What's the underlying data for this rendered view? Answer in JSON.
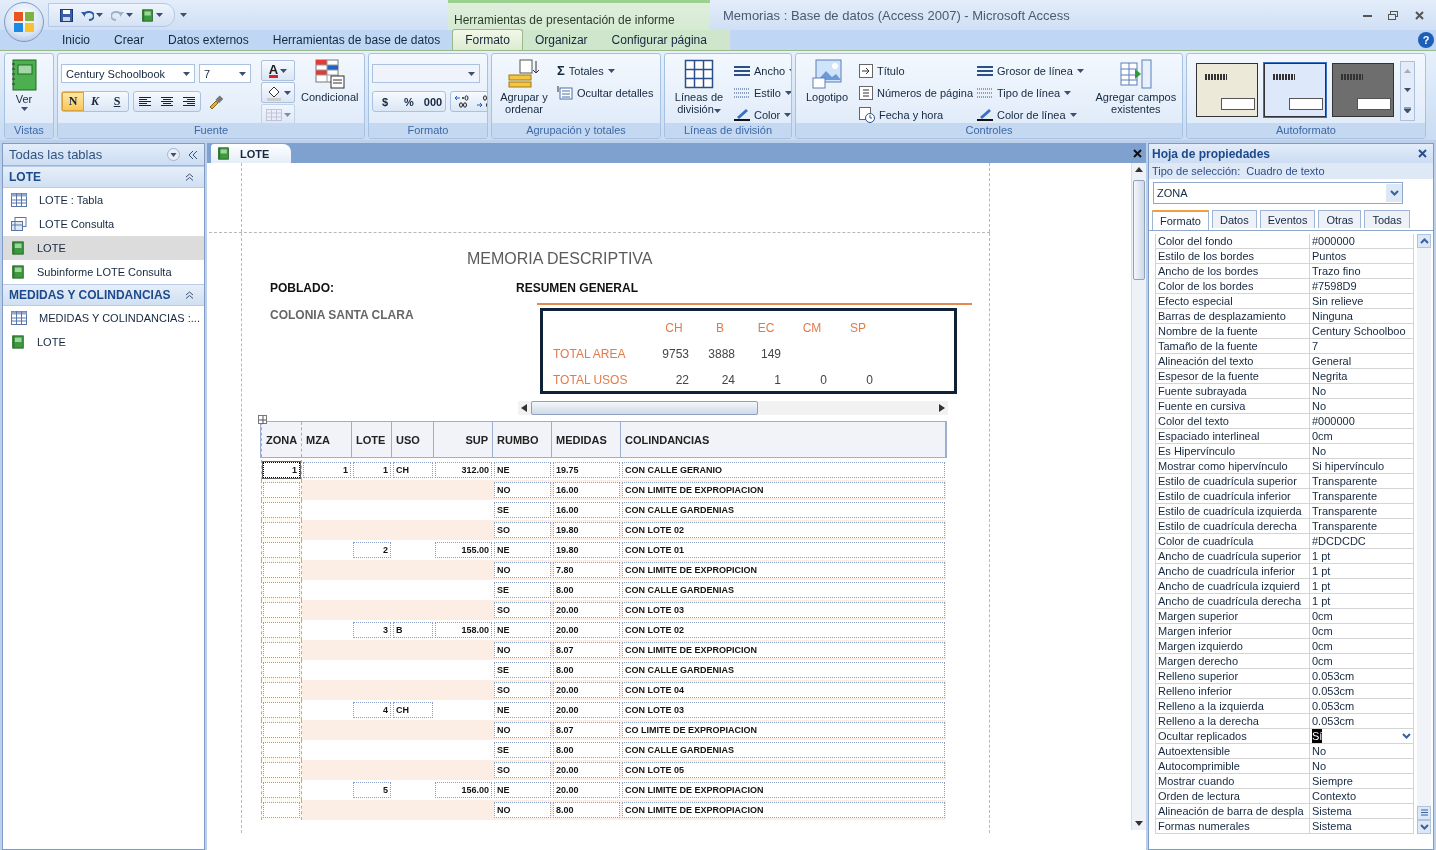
{
  "title_bar": {
    "context_group": "Herramientas de presentación de informe",
    "title": "Memorias : Base de datos (Access 2007) - Microsoft Access"
  },
  "ribbon_tabs": [
    {
      "label": "Inicio",
      "selected": false
    },
    {
      "label": "Crear",
      "selected": false
    },
    {
      "label": "Datos externos",
      "selected": false
    },
    {
      "label": "Herramientas de base de datos",
      "selected": false
    },
    {
      "label": "Formato",
      "selected": true
    },
    {
      "label": "Organizar",
      "selected": false
    },
    {
      "label": "Configurar página",
      "selected": false
    }
  ],
  "help": "?",
  "ribbon": {
    "vistas": {
      "label": "Vistas",
      "view": "Ver"
    },
    "fuente": {
      "label": "Fuente",
      "font": "Century Schoolbook",
      "size": "7",
      "styles": [
        {
          "label": "N",
          "on": true
        },
        {
          "label": "K",
          "on": false
        },
        {
          "label": "S",
          "on": false
        }
      ],
      "font_color": "A",
      "conditional": "Condicional"
    },
    "formato": {
      "label": "Formato",
      "number_formats": [
        "$",
        "%",
        "000"
      ]
    },
    "agrupacion": {
      "label": "Agrupación y totales",
      "group_sort": "Agrupar y ordenar",
      "totals_symbol": "Σ",
      "totals": "Totales",
      "hide_details": "Ocultar detalles"
    },
    "lineas": {
      "label": "Líneas de división",
      "gridlines": "Líneas de división",
      "options": [
        "Ancho",
        "Estilo",
        "Color"
      ]
    },
    "controles": {
      "label": "Controles",
      "logo": "Logotipo",
      "insert": [
        "Título",
        "Números de página",
        "Fecha y hora"
      ],
      "line": [
        "Grosor de línea",
        "Tipo de línea",
        "Color de línea"
      ],
      "add_fields": "Agregar campos existentes"
    },
    "autoformato": {
      "label": "Autoformato",
      "styles": [
        {
          "color": "#ece9d8",
          "selected": false
        },
        {
          "color": "#dde9fb",
          "selected": true
        },
        {
          "color": "#6e6e6e",
          "selected": false
        }
      ]
    }
  },
  "nav_pane": {
    "title": "Todas las tablas",
    "groups": [
      {
        "label": "LOTE",
        "expanded": true,
        "items": [
          {
            "label": "LOTE : Tabla",
            "kind": "table",
            "selected": false
          },
          {
            "label": "LOTE Consulta",
            "kind": "query",
            "selected": false
          },
          {
            "label": "LOTE",
            "kind": "report",
            "selected": true
          },
          {
            "label": "Subinforme LOTE Consulta",
            "kind": "report",
            "selected": false
          }
        ]
      },
      {
        "label": "MEDIDAS Y COLINDANCIAS",
        "expanded": true,
        "items": [
          {
            "label": "MEDIDAS Y COLINDANCIAS :...",
            "kind": "table",
            "selected": false
          },
          {
            "label": "LOTE",
            "kind": "report",
            "selected": false
          }
        ]
      }
    ]
  },
  "document_tab": {
    "label": "LOTE"
  },
  "report": {
    "title": "MEMORIA DESCRIPTIVA",
    "poblado_label": "POBLADO:",
    "poblado": "COLONIA SANTA CLARA",
    "summary_title": "RESUMEN GENERAL",
    "summary": {
      "columns": [
        "CH",
        "B",
        "EC",
        "CM",
        "SP"
      ],
      "rows": [
        {
          "label": "TOTAL AREA",
          "values": [
            "9753",
            "3888",
            "149"
          ]
        },
        {
          "label": "TOTAL USOS",
          "values": [
            "22",
            "24",
            "1",
            "0",
            "0"
          ]
        }
      ]
    },
    "columns": [
      {
        "label": "ZONA",
        "selected": true
      },
      {
        "label": "MZA",
        "selected": false
      },
      {
        "label": "LOTE",
        "selected": false
      },
      {
        "label": "USO",
        "selected": false
      },
      {
        "label": "SUP",
        "selected": false
      },
      {
        "label": "RUMBO",
        "selected": false
      },
      {
        "label": "MEDIDAS",
        "selected": false
      },
      {
        "label": "COLINDANCIAS",
        "selected": false
      }
    ],
    "rows": [
      {
        "selected": true,
        "zona": "1",
        "mza": "1",
        "lote": "1",
        "uso": "CH",
        "sup": "312.00",
        "rumbo": "NE",
        "medidas": "19.75",
        "colindancias": "CON CALLE GERANIO"
      },
      {
        "selected": false,
        "rumbo": "NO",
        "medidas": "16.00",
        "colindancias": "CON LIMITE DE EXPROPIACION"
      },
      {
        "selected": false,
        "rumbo": "SE",
        "medidas": "16.00",
        "colindancias": "CON CALLE GARDENIAS"
      },
      {
        "selected": false,
        "rumbo": "SO",
        "medidas": "19.80",
        "colindancias": "CON LOTE 02"
      },
      {
        "selected": false,
        "lote": "2",
        "sup": "155.00",
        "rumbo": "NE",
        "medidas": "19.80",
        "colindancias": "CON LOTE 01"
      },
      {
        "selected": false,
        "rumbo": "NO",
        "medidas": "7.80",
        "colindancias": "CON LIMITE DE EXPROPICION"
      },
      {
        "selected": false,
        "rumbo": "SE",
        "medidas": "8.00",
        "colindancias": "CON CALLE GARDENIAS"
      },
      {
        "selected": false,
        "rumbo": "SO",
        "medidas": "20.00",
        "colindancias": "CON LOTE 03"
      },
      {
        "selected": false,
        "lote": "3",
        "uso": "B",
        "sup": "158.00",
        "rumbo": "NE",
        "medidas": "20.00",
        "colindancias": "CON LOTE 02"
      },
      {
        "selected": false,
        "rumbo": "NO",
        "medidas": "8.07",
        "colindancias": "CON LIMITE DE EXPROPICION"
      },
      {
        "selected": false,
        "rumbo": "SE",
        "medidas": "8.00",
        "colindancias": "CON CALLE GARDENIAS"
      },
      {
        "selected": false,
        "rumbo": "SO",
        "medidas": "20.00",
        "colindancias": "CON LOTE 04"
      },
      {
        "selected": false,
        "lote": "4",
        "uso": "CH",
        "rumbo": "NE",
        "medidas": "20.00",
        "colindancias": "CON LOTE 03"
      },
      {
        "selected": false,
        "rumbo": "NO",
        "medidas": "8.07",
        "colindancias": "CO LIMITE DE EXPROPIACION"
      },
      {
        "selected": false,
        "rumbo": "SE",
        "medidas": "8.00",
        "colindancias": "CON CALLE GARDENIAS"
      },
      {
        "selected": false,
        "rumbo": "SO",
        "medidas": "20.00",
        "colindancias": "CON LOTE 05"
      },
      {
        "selected": false,
        "lote": "5",
        "sup": "156.00",
        "rumbo": "NE",
        "medidas": "20.00",
        "colindancias": "CON LIMITE DE EXPROPIACION"
      },
      {
        "selected": false,
        "rumbo": "NO",
        "medidas": "8.00",
        "colindancias": "CON LIMITE DE EXPROPIACION"
      }
    ]
  },
  "property_sheet": {
    "title": "Hoja de propiedades",
    "selection_type_label": "Tipo de selección:",
    "selection_type": "Cuadro de texto",
    "control": "ZONA",
    "tabs": [
      {
        "label": "Formato",
        "selected": true
      },
      {
        "label": "Datos",
        "selected": false
      },
      {
        "label": "Eventos",
        "selected": false
      },
      {
        "label": "Otras",
        "selected": false
      },
      {
        "label": "Todas",
        "selected": false
      }
    ],
    "properties": [
      {
        "name": "Color del fondo",
        "value": "#000000",
        "selected": false
      },
      {
        "name": "Estilo de los bordes",
        "value": "Puntos",
        "selected": false
      },
      {
        "name": "Ancho de los bordes",
        "value": "Trazo fino",
        "selected": false
      },
      {
        "name": "Color de los bordes",
        "value": "#7598D9",
        "selected": false
      },
      {
        "name": "Efecto especial",
        "value": "Sin relieve",
        "selected": false
      },
      {
        "name": "Barras de desplazamiento",
        "value": "Ninguna",
        "selected": false
      },
      {
        "name": "Nombre de la fuente",
        "value": "Century Schoolboo",
        "selected": false
      },
      {
        "name": "Tamaño de la fuente",
        "value": "7",
        "selected": false
      },
      {
        "name": "Alineación del texto",
        "value": "General",
        "selected": false
      },
      {
        "name": "Espesor de la fuente",
        "value": "Negrita",
        "selected": false
      },
      {
        "name": "Fuente subrayada",
        "value": "No",
        "selected": false
      },
      {
        "name": "Fuente en cursiva",
        "value": "No",
        "selected": false
      },
      {
        "name": "Color del texto",
        "value": "#000000",
        "selected": false
      },
      {
        "name": "Espaciado interlineal",
        "value": "0cm",
        "selected": false
      },
      {
        "name": "Es Hipervínculo",
        "value": "No",
        "selected": false
      },
      {
        "name": "Mostrar como hipervínculo",
        "value": "Si hipervínculo",
        "selected": false
      },
      {
        "name": "Estilo de cuadrícula superior",
        "value": "Transparente",
        "selected": false
      },
      {
        "name": "Estilo de cuadrícula inferior",
        "value": "Transparente",
        "selected": false
      },
      {
        "name": "Estilo de cuadrícula izquierda",
        "value": "Transparente",
        "selected": false
      },
      {
        "name": "Estilo de cuadrícula derecha",
        "value": "Transparente",
        "selected": false
      },
      {
        "name": "Color de cuadrícula",
        "value": "#DCDCDC",
        "selected": false
      },
      {
        "name": "Ancho de cuadrícula superior",
        "value": "1 pt",
        "selected": false
      },
      {
        "name": "Ancho de cuadrícula inferior",
        "value": "1 pt",
        "selected": false
      },
      {
        "name": "Ancho de cuadrícula izquierd",
        "value": "1 pt",
        "selected": false
      },
      {
        "name": "Ancho de cuadrícula derecha",
        "value": "1 pt",
        "selected": false
      },
      {
        "name": "Margen superior",
        "value": "0cm",
        "selected": false
      },
      {
        "name": "Margen inferior",
        "value": "0cm",
        "selected": false
      },
      {
        "name": "Margen izquierdo",
        "value": "0cm",
        "selected": false
      },
      {
        "name": "Margen derecho",
        "value": "0cm",
        "selected": false
      },
      {
        "name": "Relleno superior",
        "value": "0.053cm",
        "selected": false
      },
      {
        "name": "Relleno inferior",
        "value": "0.053cm",
        "selected": false
      },
      {
        "name": "Relleno a la izquierda",
        "value": "0.053cm",
        "selected": false
      },
      {
        "name": "Relleno a la derecha",
        "value": "0.053cm",
        "selected": false
      },
      {
        "name": "Ocultar replicados",
        "value": "Sí",
        "selected": true
      },
      {
        "name": "Autoextensible",
        "value": "No",
        "selected": false
      },
      {
        "name": "Autocomprimible",
        "value": "No",
        "selected": false
      },
      {
        "name": "Mostrar cuando",
        "value": "Siempre",
        "selected": false
      },
      {
        "name": "Orden de lectura",
        "value": "Contexto",
        "selected": false
      },
      {
        "name": "Alineación de barra de despla",
        "value": "Sistema",
        "selected": false
      },
      {
        "name": "Formas numerales",
        "value": "Sistema",
        "selected": false
      }
    ]
  }
}
